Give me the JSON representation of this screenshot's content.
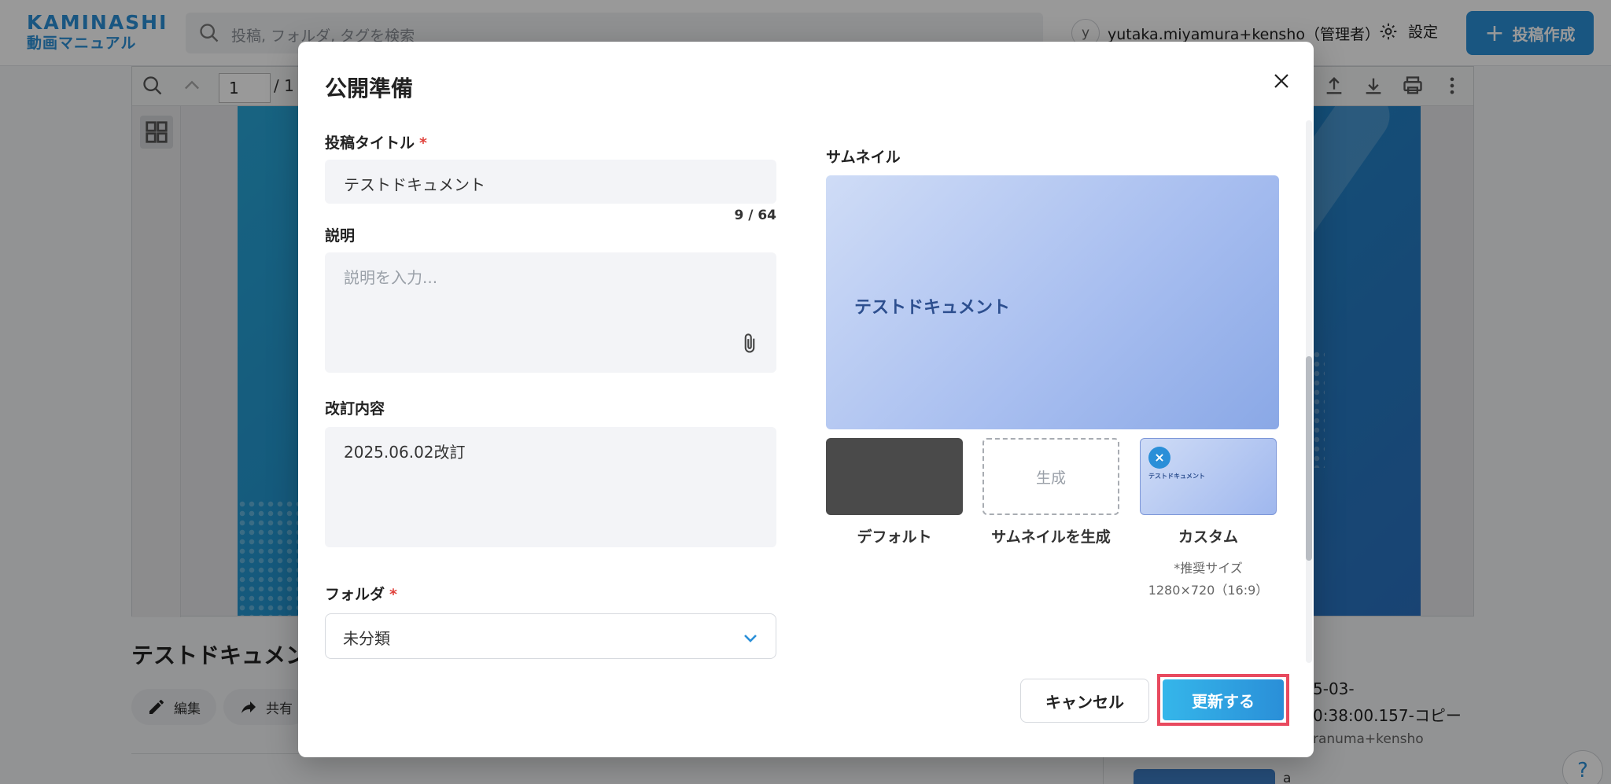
{
  "app": {
    "logo_line1": "KAMINASHI",
    "logo_line2": "動画マニュアル",
    "search_placeholder": "投稿, フォルダ, タグを検索",
    "avatar_initial": "y",
    "user_name": "yutaka.miyamura+kensho（管理者）",
    "settings_label": "設定",
    "create_label": "投稿作成"
  },
  "viewer": {
    "page_value": "1",
    "page_total": "/ 1"
  },
  "background": {
    "doc_title": "テストドキュメン",
    "edit_label": "編集",
    "share_label": "共有",
    "side_line1": "5-03-",
    "side_line2": "0:38:00.157-コピー",
    "side_line3": "ranuma+kensho",
    "side_line4": "a",
    "help_label": "?"
  },
  "modal": {
    "title": "公開準備",
    "post_title": {
      "label": "投稿タイトル",
      "required_mark": "*",
      "value": "テストドキュメント",
      "counter": "9 / 64"
    },
    "description": {
      "label": "説明",
      "placeholder": "説明を入力..."
    },
    "revision": {
      "label": "改訂内容",
      "value": "2025.06.02改訂"
    },
    "folder": {
      "label": "フォルダ",
      "required_mark": "*",
      "value": "未分類"
    },
    "thumbnail": {
      "label": "サムネイル",
      "preview_text": "テストドキュメント",
      "generate_box": "生成",
      "custom_mini_text": "テストドキュメント",
      "options": {
        "default": "デフォルト",
        "generate": "サムネイルを生成",
        "custom": "カスタム"
      },
      "recommend_line1": "*推奨サイズ",
      "recommend_line2": "1280×720（16:9）"
    },
    "cancel_label": "キャンセル",
    "update_label": "更新する"
  },
  "colors": {
    "brand": "#2a8fd8",
    "required": "#e0423c",
    "highlight": "#e84a5f"
  }
}
